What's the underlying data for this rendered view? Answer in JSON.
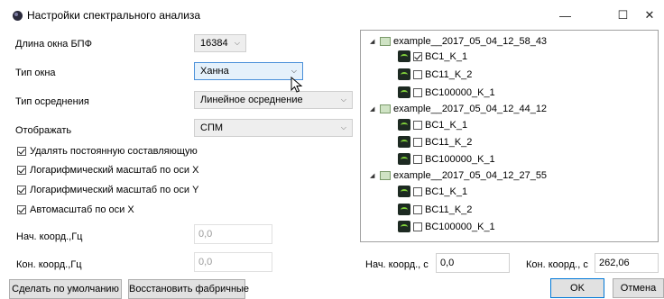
{
  "window": {
    "title": "Настройки спектрального анализа",
    "minimize": "—",
    "maximize": "☐",
    "close": "✕"
  },
  "settings": {
    "fft_window_label": "Длина окна БПФ",
    "fft_window_value": "16384",
    "window_type_label": "Тип окна",
    "window_type_value": "Ханна",
    "averaging_label": "Тип осреднения",
    "averaging_value": "Линейное осреднение",
    "display_label": "Отображать",
    "display_value": "СПМ"
  },
  "options": [
    {
      "label": "Удалять постоянную составляющую",
      "checked": true
    },
    {
      "label": "Логарифмический масштаб по оси X",
      "checked": true
    },
    {
      "label": "Логарифмический масштаб по оси Y",
      "checked": true
    },
    {
      "label": "Автомасштаб по оси X",
      "checked": true
    }
  ],
  "freq": {
    "start_label": "Нач. коорд.,Гц",
    "start_value": "0,0",
    "end_label": "Кон. коорд.,Гц",
    "end_value": "0,0"
  },
  "time": {
    "start_label": "Нач. коорд., с",
    "start_value": "0,0",
    "end_label": "Кон. коорд., с",
    "end_value": "262,06"
  },
  "tree": {
    "groups": [
      {
        "name": "example__2017_05_04_12_58_43",
        "channels": [
          {
            "name": "BC1_K_1",
            "checked": true
          },
          {
            "name": "BC11_K_2",
            "checked": false
          },
          {
            "name": "BC100000_K_1",
            "checked": false
          }
        ]
      },
      {
        "name": "example__2017_05_04_12_44_12",
        "channels": [
          {
            "name": "BC1_K_1",
            "checked": false
          },
          {
            "name": "BC11_K_2",
            "checked": false
          },
          {
            "name": "BC100000_K_1",
            "checked": false
          }
        ]
      },
      {
        "name": "example__2017_05_04_12_27_55",
        "channels": [
          {
            "name": "BC1_K_1",
            "checked": false
          },
          {
            "name": "BC11_K_2",
            "checked": false
          },
          {
            "name": "BC100000_K_1",
            "checked": false
          }
        ]
      }
    ]
  },
  "buttons": {
    "defaults": "Сделать по умолчанию",
    "restore": "Восстановить фабричные",
    "ok": "OK",
    "cancel": "Отмена"
  },
  "icons": {
    "app": "app-icon",
    "dropdown": "chevron-down-icon",
    "folder": "folder-icon",
    "channel": "signal-channel-icon",
    "cursor": "mouse-pointer-icon"
  }
}
